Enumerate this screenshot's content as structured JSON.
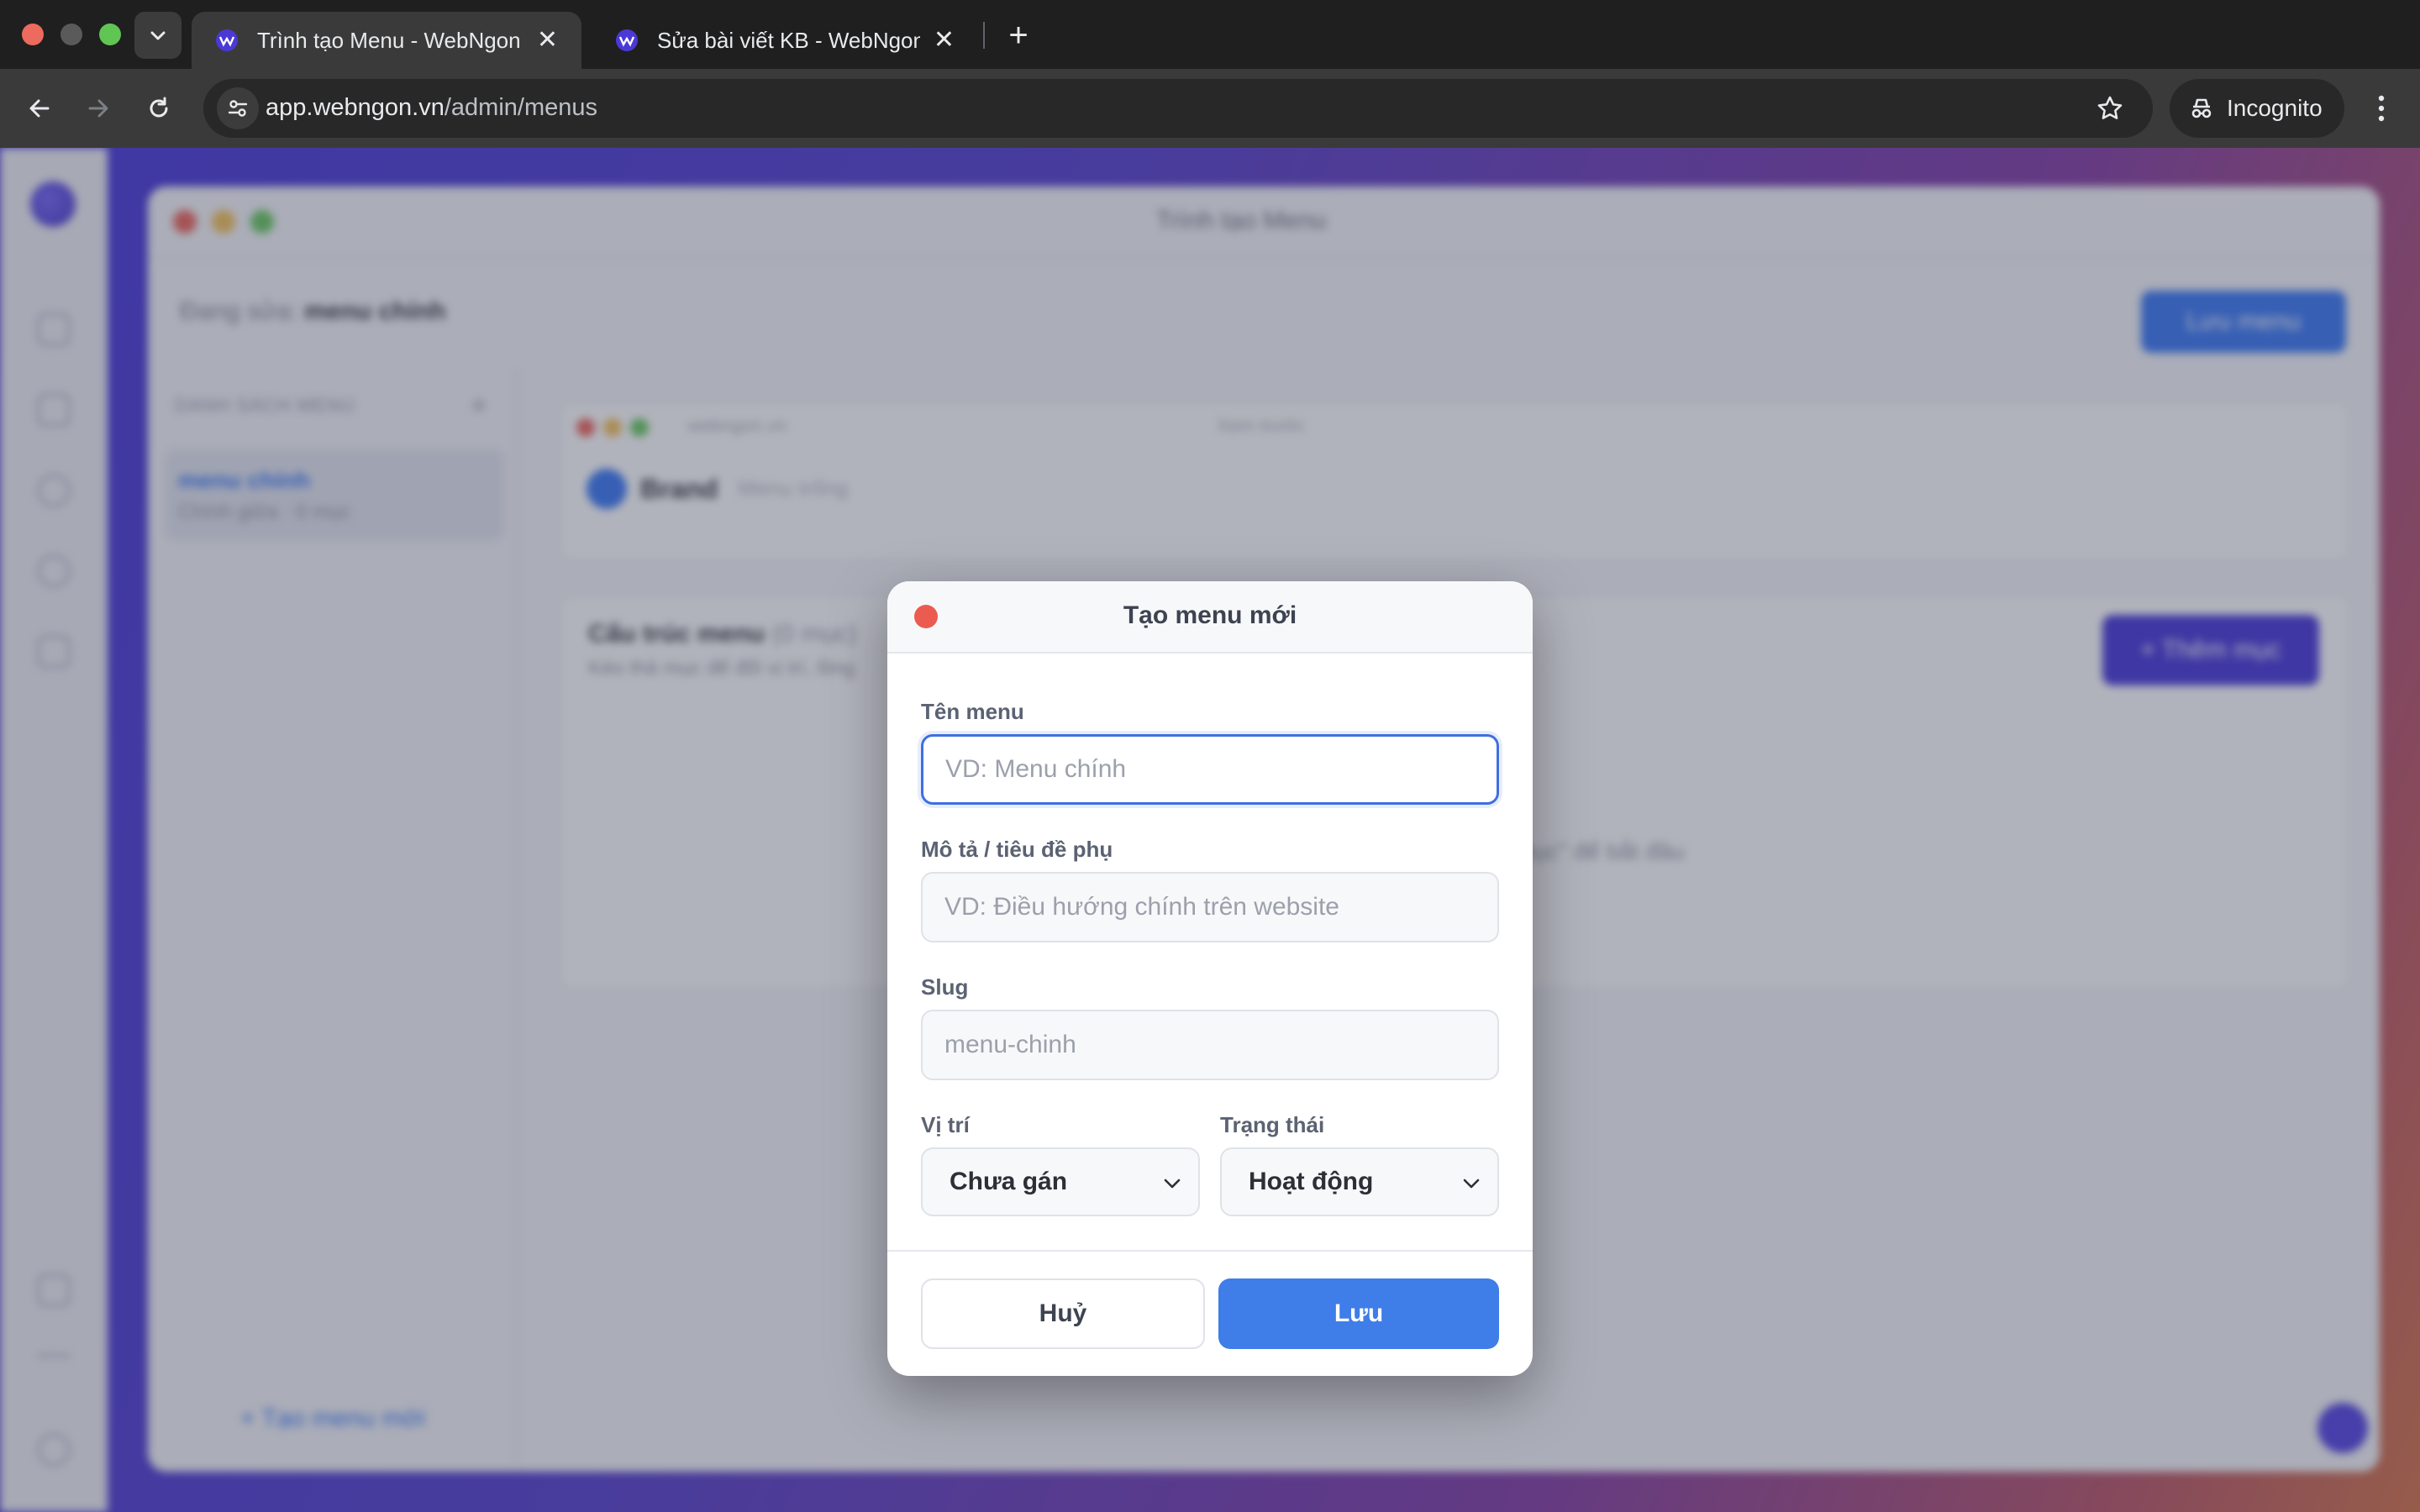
{
  "browser": {
    "tabs": [
      {
        "title": "Trình tạo Menu - WebNgon",
        "active": true
      },
      {
        "title": "Sửa bài viết KB - WebNgon",
        "active": false
      }
    ],
    "url_host": "app.webngon.vn",
    "url_path": "/admin/menus",
    "incognito_label": "Incognito",
    "accent": "#3f7de8"
  },
  "background_app": {
    "window_title": "Trình tạo Menu",
    "editing_label": "Đang sửa:",
    "editing_value": "menu chính",
    "save_menu_label": "Lưu menu",
    "list_heading": "DANH SÁCH MENU",
    "list_add": "+",
    "list_item_name": "menu chính",
    "list_item_meta": "Chính giữa · 0 mục",
    "preview_url": "webngon.vn",
    "preview_tab": "Xem trước",
    "preview_brand": "Brand",
    "preview_empty": "Menu trống",
    "tree_title": "Cấu trúc menu",
    "tree_count": "(0 mục)",
    "tree_subtitle": "Kéo thả mục để đổi vị trí, lồng",
    "add_item_label": "+ Thêm mục",
    "tree_empty_hint": "mục\" để bắt đầu",
    "new_menu_link": "+ Tạo menu mới"
  },
  "modal": {
    "title": "Tạo menu mới",
    "name_label": "Tên menu",
    "name_placeholder": "VD: Menu chính",
    "desc_label": "Mô tả / tiêu đề phụ",
    "desc_placeholder": "VD: Điều hướng chính trên website",
    "slug_label": "Slug",
    "slug_placeholder": "menu-chinh",
    "position_label": "Vị trí",
    "position_value": "Chưa gán",
    "status_label": "Trạng thái",
    "status_value": "Hoạt động",
    "cancel_label": "Huỷ",
    "save_label": "Lưu"
  }
}
